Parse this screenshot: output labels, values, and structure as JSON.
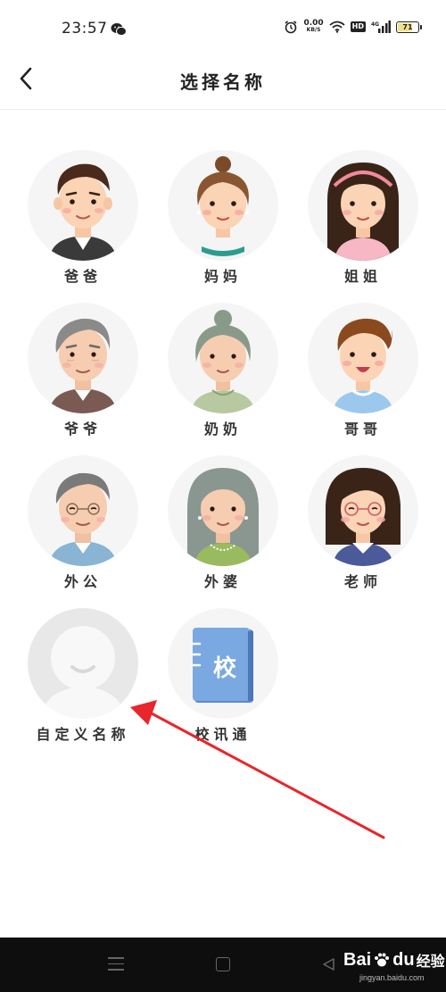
{
  "status_bar": {
    "time": "23:57",
    "net_speed_value": "0.00",
    "net_speed_unit": "KB/S",
    "hd_badge": "HD",
    "signal_label": "4G",
    "battery_percent": "71"
  },
  "header": {
    "title": "选择名称"
  },
  "roles": [
    {
      "label": "爸爸",
      "icon": "dad-avatar-icon"
    },
    {
      "label": "妈妈",
      "icon": "mom-avatar-icon"
    },
    {
      "label": "姐姐",
      "icon": "older-sister-avatar-icon"
    },
    {
      "label": "爷爷",
      "icon": "grandpa-avatar-icon"
    },
    {
      "label": "奶奶",
      "icon": "grandma-avatar-icon"
    },
    {
      "label": "哥哥",
      "icon": "older-brother-avatar-icon"
    },
    {
      "label": "外公",
      "icon": "maternal-grandpa-avatar-icon"
    },
    {
      "label": "外婆",
      "icon": "maternal-grandma-avatar-icon"
    },
    {
      "label": "老师",
      "icon": "teacher-avatar-icon"
    },
    {
      "label": "自定义名称",
      "icon": "custom-avatar-icon"
    },
    {
      "label": "校讯通",
      "icon": "school-book-icon",
      "book_char": "校"
    }
  ],
  "watermark": {
    "brand_a": "Bai",
    "brand_b": "du",
    "suffix": "经验",
    "url": "jingyan.baidu.com"
  },
  "colors": {
    "accent_arrow": "#e8262b",
    "avatar_bg": "#f5f5f5",
    "book_blue": "#7aa8e0"
  }
}
